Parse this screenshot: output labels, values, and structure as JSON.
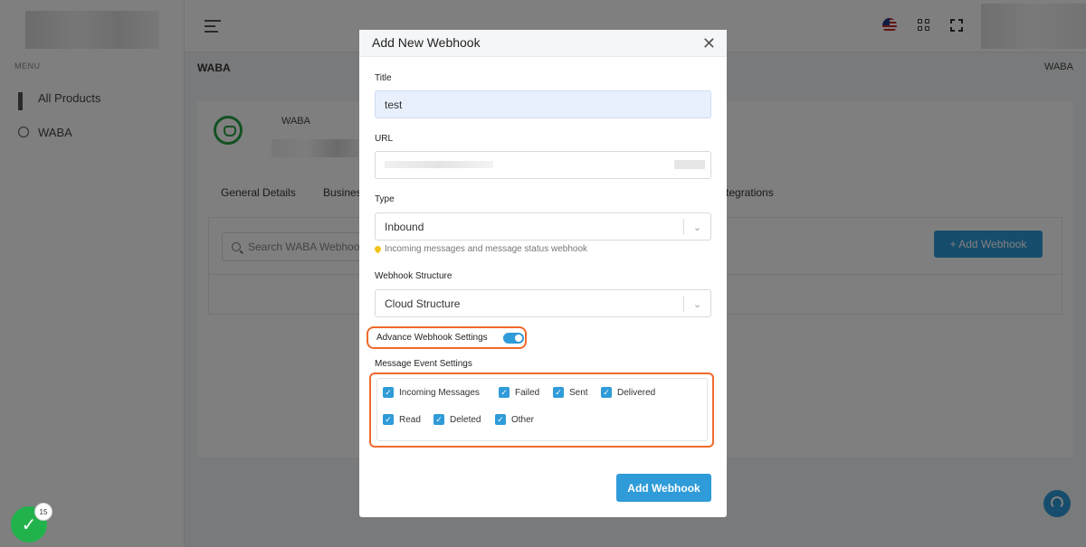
{
  "sidebar": {
    "menu_label": "MENU",
    "items": [
      {
        "label": "All Products",
        "icon": "grid-icon"
      },
      {
        "label": "WABA",
        "icon": "whatsapp-icon"
      }
    ]
  },
  "header": {
    "breadcrumb_left": "WABA",
    "breadcrumb_right": "WABA"
  },
  "card": {
    "name": "WABA",
    "tabs": [
      "General Details",
      "Busines",
      "Integrations"
    ],
    "search_placeholder": "Search WABA Webhooks",
    "add_button_label": "+ Add Webhook"
  },
  "modal": {
    "title": "Add New Webhook",
    "close_glyph": "✕",
    "title_label": "Title",
    "title_value": "test",
    "url_label": "URL",
    "type_label": "Type",
    "type_value": "Inbound",
    "type_hint": "Incoming messages and message status webhook",
    "structure_label": "Webhook Structure",
    "structure_value": "Cloud Structure",
    "advance_label": "Advance Webhook Settings",
    "advance_enabled": true,
    "events_label": "Message Event Settings",
    "events": [
      {
        "label": "Incoming Messages",
        "checked": true
      },
      {
        "label": "Failed",
        "checked": true
      },
      {
        "label": "Sent",
        "checked": true
      },
      {
        "label": "Delivered",
        "checked": true
      },
      {
        "label": "Read",
        "checked": true
      },
      {
        "label": "Deleted",
        "checked": true
      },
      {
        "label": "Other",
        "checked": true
      }
    ],
    "submit_label": "Add Webhook"
  },
  "fab": {
    "badge_count": "15"
  },
  "colors": {
    "accent": "#2f9bd8",
    "highlight": "#f06a2c",
    "success": "#22b24c"
  }
}
